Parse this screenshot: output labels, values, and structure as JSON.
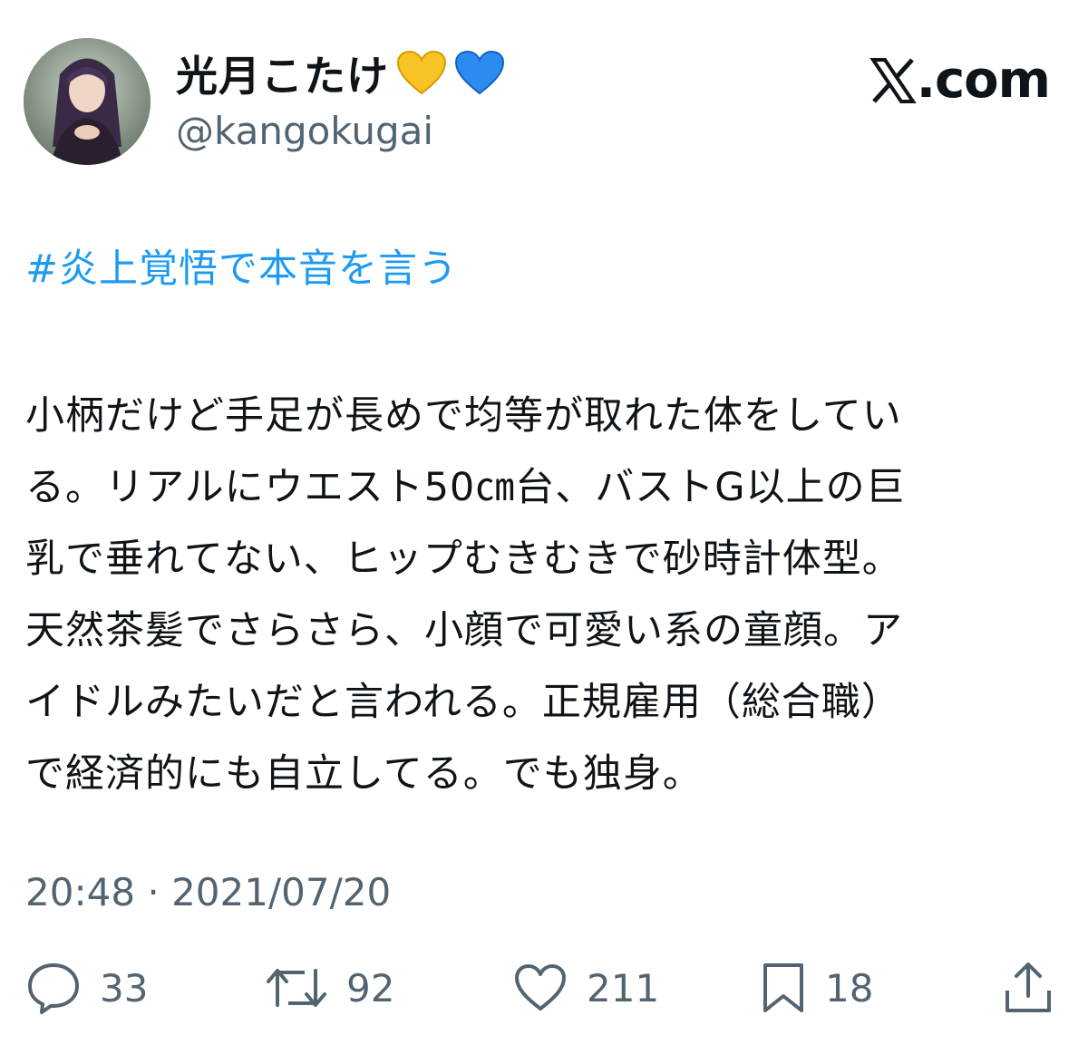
{
  "author": {
    "display_name": "光月こたけ",
    "heart_emojis": [
      "yellow-heart",
      "blue-heart"
    ],
    "handle": "@kangokugai"
  },
  "brand": {
    "label": ".com"
  },
  "tweet": {
    "hashtag": "#炎上覚悟で本音を言う",
    "body_lines": [
      "小柄だけど手足が長めで均等が取れた体をしてい",
      "る。リアルにウエスト50㎝台、バストG以上の巨",
      "乳で垂れてない、ヒップむきむきで砂時計体型。",
      "天然茶髪でさらさら、小顔で可愛い系の童顔。ア",
      "イドルみたいだと言われる。正規雇用（総合職）",
      "で経済的にも自立してる。でも独身。"
    ],
    "timestamp": "20:48 · 2021/07/20"
  },
  "actions": {
    "reply": {
      "icon": "reply-icon",
      "count": "33"
    },
    "repost": {
      "icon": "repost-icon",
      "count": "92"
    },
    "like": {
      "icon": "heart-icon",
      "count": "211"
    },
    "bookmark": {
      "icon": "bookmark-icon",
      "count": "18"
    },
    "share": {
      "icon": "share-icon"
    }
  },
  "colors": {
    "link": "#1d9bf0",
    "secondary": "#536471",
    "text": "#0f1419"
  }
}
